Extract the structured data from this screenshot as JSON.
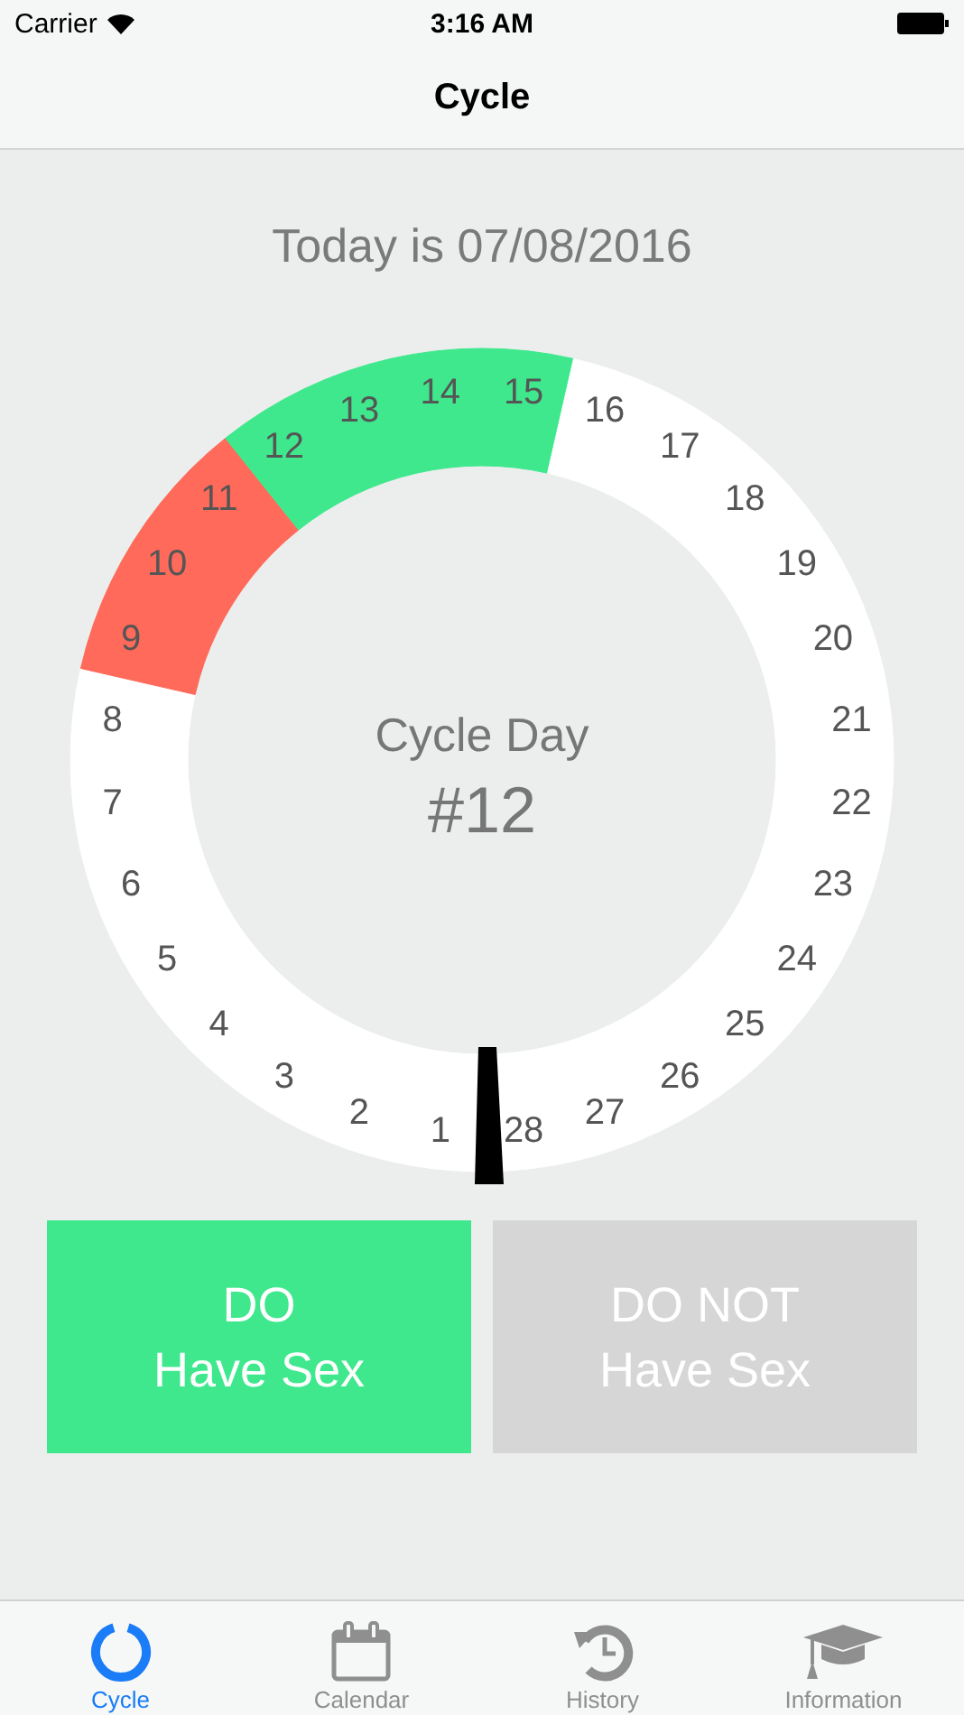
{
  "status_bar": {
    "carrier": "Carrier",
    "time": "3:16 AM"
  },
  "nav": {
    "title": "Cycle"
  },
  "today": "Today is 07/08/2016",
  "cycle": {
    "label": "Cycle Day",
    "day": "#12",
    "days": [
      {
        "label": "1",
        "color": "#ffffff"
      },
      {
        "label": "2",
        "color": "#ffffff"
      },
      {
        "label": "3",
        "color": "#ffffff"
      },
      {
        "label": "4",
        "color": "#ffffff"
      },
      {
        "label": "5",
        "color": "#ffffff"
      },
      {
        "label": "6",
        "color": "#ffffff"
      },
      {
        "label": "7",
        "color": "#ffffff"
      },
      {
        "label": "8",
        "color": "#ffffff"
      },
      {
        "label": "9",
        "color": "#ff6a5a"
      },
      {
        "label": "10",
        "color": "#ff6a5a"
      },
      {
        "label": "11",
        "color": "#ff6a5a"
      },
      {
        "label": "12",
        "color": "#3fe88d"
      },
      {
        "label": "13",
        "color": "#3fe88d"
      },
      {
        "label": "14",
        "color": "#3fe88d"
      },
      {
        "label": "15",
        "color": "#3fe88d"
      },
      {
        "label": "16",
        "color": "#ffffff"
      },
      {
        "label": "17",
        "color": "#ffffff"
      },
      {
        "label": "18",
        "color": "#ffffff"
      },
      {
        "label": "19",
        "color": "#ffffff"
      },
      {
        "label": "20",
        "color": "#ffffff"
      },
      {
        "label": "21",
        "color": "#ffffff"
      },
      {
        "label": "22",
        "color": "#ffffff"
      },
      {
        "label": "23",
        "color": "#ffffff"
      },
      {
        "label": "24",
        "color": "#ffffff"
      },
      {
        "label": "25",
        "color": "#ffffff"
      },
      {
        "label": "26",
        "color": "#ffffff"
      },
      {
        "label": "27",
        "color": "#ffffff"
      },
      {
        "label": "28",
        "color": "#ffffff"
      }
    ]
  },
  "buttons": [
    {
      "lines": [
        "DO",
        "Have Sex"
      ],
      "active": true
    },
    {
      "lines": [
        "DO NOT",
        "Have Sex"
      ],
      "active": false
    }
  ],
  "tabs": [
    {
      "label": "Cycle",
      "kind": "ring",
      "selected": true
    },
    {
      "label": "Calendar",
      "kind": "calendar",
      "selected": false
    },
    {
      "label": "History",
      "kind": "history",
      "selected": false
    },
    {
      "label": "Information",
      "kind": "cap",
      "selected": false
    }
  ]
}
